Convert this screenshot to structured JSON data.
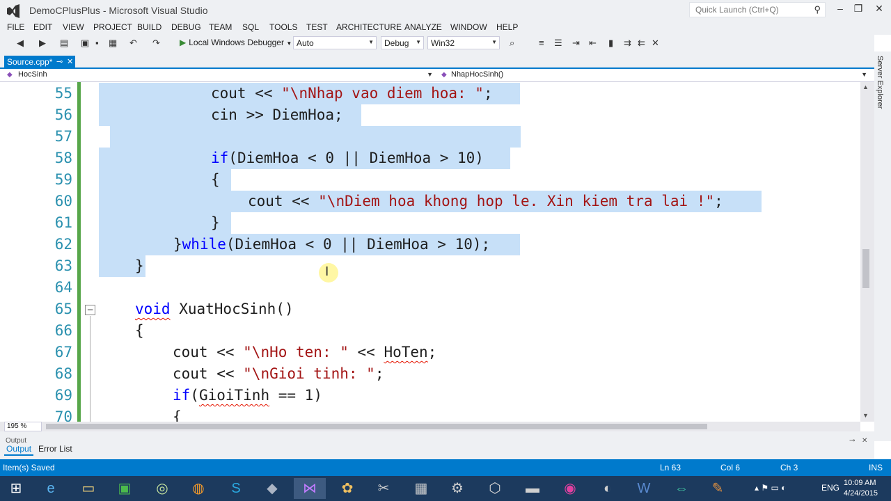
{
  "window": {
    "title": "DemoCPlusPlus - Microsoft Visual Studio",
    "quick_launch_placeholder": "Quick Launch (Ctrl+Q)"
  },
  "menu": [
    "FILE",
    "EDIT",
    "VIEW",
    "PROJECT",
    "BUILD",
    "DEBUG",
    "TEAM",
    "SQL",
    "TOOLS",
    "TEST",
    "ARCHITECTURE",
    "ANALYZE",
    "WINDOW",
    "HELP"
  ],
  "toolbar": {
    "debugger_label": "Local Windows Debugger",
    "debugger_target": "Auto",
    "configuration": "Debug",
    "platform": "Win32"
  },
  "side_panel": {
    "server_explorer": "Server Explorer"
  },
  "tabs": [
    {
      "label": "Source.cpp*",
      "active": true
    }
  ],
  "navbar": {
    "left": "HocSinh",
    "right": "NhapHocSinh()"
  },
  "editor": {
    "zoom": "195 %",
    "lines": [
      {
        "num": "55",
        "selected": true
      },
      {
        "num": "56",
        "selected": true
      },
      {
        "num": "57",
        "selected": true
      },
      {
        "num": "58",
        "selected": true
      },
      {
        "num": "59",
        "selected": true
      },
      {
        "num": "60",
        "selected": true
      },
      {
        "num": "61",
        "selected": true
      },
      {
        "num": "62",
        "selected": true
      },
      {
        "num": "63",
        "selected": true
      },
      {
        "num": "64",
        "selected": false
      },
      {
        "num": "65",
        "selected": false
      },
      {
        "num": "66",
        "selected": false
      },
      {
        "num": "67",
        "selected": false
      },
      {
        "num": "68",
        "selected": false
      },
      {
        "num": "69",
        "selected": false
      },
      {
        "num": "70",
        "selected": false
      }
    ],
    "tokens": {
      "l55_a": "cout << ",
      "l55_b": "\"\\nNhap vao diem hoa: \"",
      "l55_c": ";",
      "l56": "cin >> DiemHoa;",
      "l58_kw": "if",
      "l58_rest": "(DiemHoa < 0 || DiemHoa > 10)",
      "l59": "{",
      "l60_a": "cout << ",
      "l60_b": "\"\\nDiem hoa khong hop le. Xin kiem tra lai !\"",
      "l60_c": ";",
      "l61": "}",
      "l62_a": "}",
      "l62_kw": "while",
      "l62_rest": "(DiemHoa < 0 || DiemHoa > 10);",
      "l63": "}",
      "l65_kw": "void",
      "l65_rest": " XuatHocSinh()",
      "l66": "{",
      "l67_a": "cout << ",
      "l67_b": "\"\\nHo ten: \"",
      "l67_c": " << ",
      "l67_d": "HoTen",
      "l67_e": ";",
      "l68_a": "cout << ",
      "l68_b": "\"\\nGioi tinh: \"",
      "l68_c": ";",
      "l69_kw": "if",
      "l69_a": "(",
      "l69_b": "GioiTinh",
      "l69_c": " == 1)",
      "l70": "{"
    }
  },
  "output": {
    "title": "Output",
    "tabs": [
      "Output",
      "Error List"
    ]
  },
  "status": {
    "message": "Item(s) Saved",
    "ln": "Ln 63",
    "col": "Col 6",
    "ch": "Ch 3",
    "mode": "INS"
  },
  "taskbar": {
    "lang": "ENG",
    "time": "10:09 AM",
    "date": "4/24/2015"
  },
  "colors": {
    "accent": "#007acc",
    "selection": "#c7e0f8",
    "keyword": "#0000ff",
    "string": "#a31515",
    "line_number": "#2b91af",
    "change_bar": "#57a64a"
  }
}
